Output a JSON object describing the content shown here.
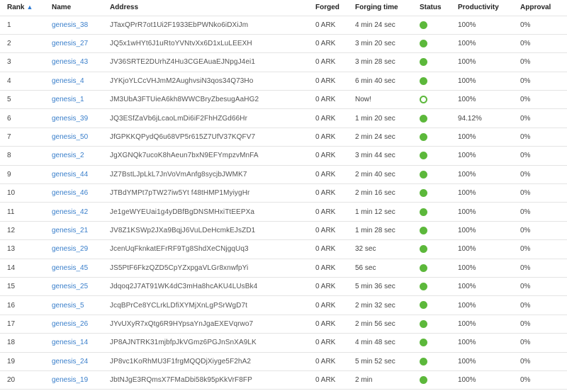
{
  "table": {
    "headers": {
      "rank": "Rank",
      "name": "Name",
      "address": "Address",
      "forged": "Forged",
      "forging_time": "Forging time",
      "status": "Status",
      "productivity": "Productivity",
      "approval": "Approval"
    },
    "sort_indicator": "▲",
    "status_colors": {
      "forging": "#5cb83b",
      "link": "#3a7fcb"
    },
    "rows": [
      {
        "rank": "1",
        "name": "genesis_38",
        "address": "JTaxQPrR7ot1Ui2F1933EbPWNko6iDXiJm",
        "forged": "0 ARK",
        "forging_time": "4 min 24 sec",
        "status": "forging",
        "productivity": "100%",
        "approval": "0%"
      },
      {
        "rank": "2",
        "name": "genesis_27",
        "address": "JQ5x1wHYt6J1uRtoYVNtvXx6D1xLuLEEXH",
        "forged": "0 ARK",
        "forging_time": "3 min 20 sec",
        "status": "forging",
        "productivity": "100%",
        "approval": "0%"
      },
      {
        "rank": "3",
        "name": "genesis_43",
        "address": "JV36SRTE2DUrhZ4Hu3CGEAuaEJNpgJ4ei1",
        "forged": "0 ARK",
        "forging_time": "3 min 28 sec",
        "status": "forging",
        "productivity": "100%",
        "approval": "0%"
      },
      {
        "rank": "4",
        "name": "genesis_4",
        "address": "JYKjoYLCcVHJmM2AughvsiN3qos34Q73Ho",
        "forged": "0 ARK",
        "forging_time": "6 min 40 sec",
        "status": "forging",
        "productivity": "100%",
        "approval": "0%"
      },
      {
        "rank": "5",
        "name": "genesis_1",
        "address": "JM3UbA3FTUieA6kh8WWCBryZbesugAaHG2",
        "forged": "0 ARK",
        "forging_time": "Now!",
        "status": "waiting",
        "productivity": "100%",
        "approval": "0%"
      },
      {
        "rank": "6",
        "name": "genesis_39",
        "address": "JQ3ESfZaVb6jLcaoLmDi6iF2FhHZGd66Hr",
        "forged": "0 ARK",
        "forging_time": "1 min 20 sec",
        "status": "forging",
        "productivity": "94.12%",
        "approval": "0%"
      },
      {
        "rank": "7",
        "name": "genesis_50",
        "address": "JfGPKKQPydQ6u68VP5r615Z7UfV37KQFV7",
        "forged": "0 ARK",
        "forging_time": "2 min 24 sec",
        "status": "forging",
        "productivity": "100%",
        "approval": "0%"
      },
      {
        "rank": "8",
        "name": "genesis_2",
        "address": "JgXGNQk7ucoK8hAeun7bxN9EFYmpzvMnFA",
        "forged": "0 ARK",
        "forging_time": "3 min 44 sec",
        "status": "forging",
        "productivity": "100%",
        "approval": "0%"
      },
      {
        "rank": "9",
        "name": "genesis_44",
        "address": "JZ7BstLJpLkL7JnVoVmAnfg8sycjbJWMK7",
        "forged": "0 ARK",
        "forging_time": "2 min 40 sec",
        "status": "forging",
        "productivity": "100%",
        "approval": "0%"
      },
      {
        "rank": "10",
        "name": "genesis_46",
        "address": "JTBdYMPt7pTW27iw5Yt f48tHMP1MyiygHr",
        "forged": "0 ARK",
        "forging_time": "2 min 16 sec",
        "status": "forging",
        "productivity": "100%",
        "approval": "0%"
      },
      {
        "rank": "11",
        "name": "genesis_42",
        "address": "Je1geWYEUai1g4yDBfBgDNSMHxiTtEEPXa",
        "forged": "0 ARK",
        "forging_time": "1 min 12 sec",
        "status": "forging",
        "productivity": "100%",
        "approval": "0%"
      },
      {
        "rank": "12",
        "name": "genesis_21",
        "address": "JV8Z1KSWp2JXa9BqjJ6VuLDeHcmkEJsZD1",
        "forged": "0 ARK",
        "forging_time": "1 min 28 sec",
        "status": "forging",
        "productivity": "100%",
        "approval": "0%"
      },
      {
        "rank": "13",
        "name": "genesis_29",
        "address": "JcenUqFknkatEFrRF9Tg8ShdXeCNjgqUq3",
        "forged": "0 ARK",
        "forging_time": "32 sec",
        "status": "forging",
        "productivity": "100%",
        "approval": "0%"
      },
      {
        "rank": "14",
        "name": "genesis_45",
        "address": "JS5PtF6FkzQZD5CpYZxpgaVLGr8xnwfpYi",
        "forged": "0 ARK",
        "forging_time": "56 sec",
        "status": "forging",
        "productivity": "100%",
        "approval": "0%"
      },
      {
        "rank": "15",
        "name": "genesis_25",
        "address": "Jdqoq2J7AT91WK4dC3mHa8hcAKU4LUsBk4",
        "forged": "0 ARK",
        "forging_time": "5 min 36 sec",
        "status": "forging",
        "productivity": "100%",
        "approval": "0%"
      },
      {
        "rank": "16",
        "name": "genesis_5",
        "address": "JcqBPrCe8YCLrkLDfiXYMjXnLgPSrWgD7t",
        "forged": "0 ARK",
        "forging_time": "2 min 32 sec",
        "status": "forging",
        "productivity": "100%",
        "approval": "0%"
      },
      {
        "rank": "17",
        "name": "genesis_26",
        "address": "JYvUXyR7xQtg6R9HYpsaYnJgaEXEVqrwo7",
        "forged": "0 ARK",
        "forging_time": "2 min 56 sec",
        "status": "forging",
        "productivity": "100%",
        "approval": "0%"
      },
      {
        "rank": "18",
        "name": "genesis_14",
        "address": "JP8AJNTRK31mjbfpJkVGmz6PGJnSnXA9LK",
        "forged": "0 ARK",
        "forging_time": "4 min 48 sec",
        "status": "forging",
        "productivity": "100%",
        "approval": "0%"
      },
      {
        "rank": "19",
        "name": "genesis_24",
        "address": "JP8vc1KoRhMU3F1frgMQQDjXiyge5F2hA2",
        "forged": "0 ARK",
        "forging_time": "5 min 52 sec",
        "status": "forging",
        "productivity": "100%",
        "approval": "0%"
      },
      {
        "rank": "20",
        "name": "genesis_19",
        "address": "JbtNJgE3RQmsX7FMaDbi58k95pKkVrF8FP",
        "forged": "0 ARK",
        "forging_time": "2 min",
        "status": "forging",
        "productivity": "100%",
        "approval": "0%"
      }
    ]
  }
}
